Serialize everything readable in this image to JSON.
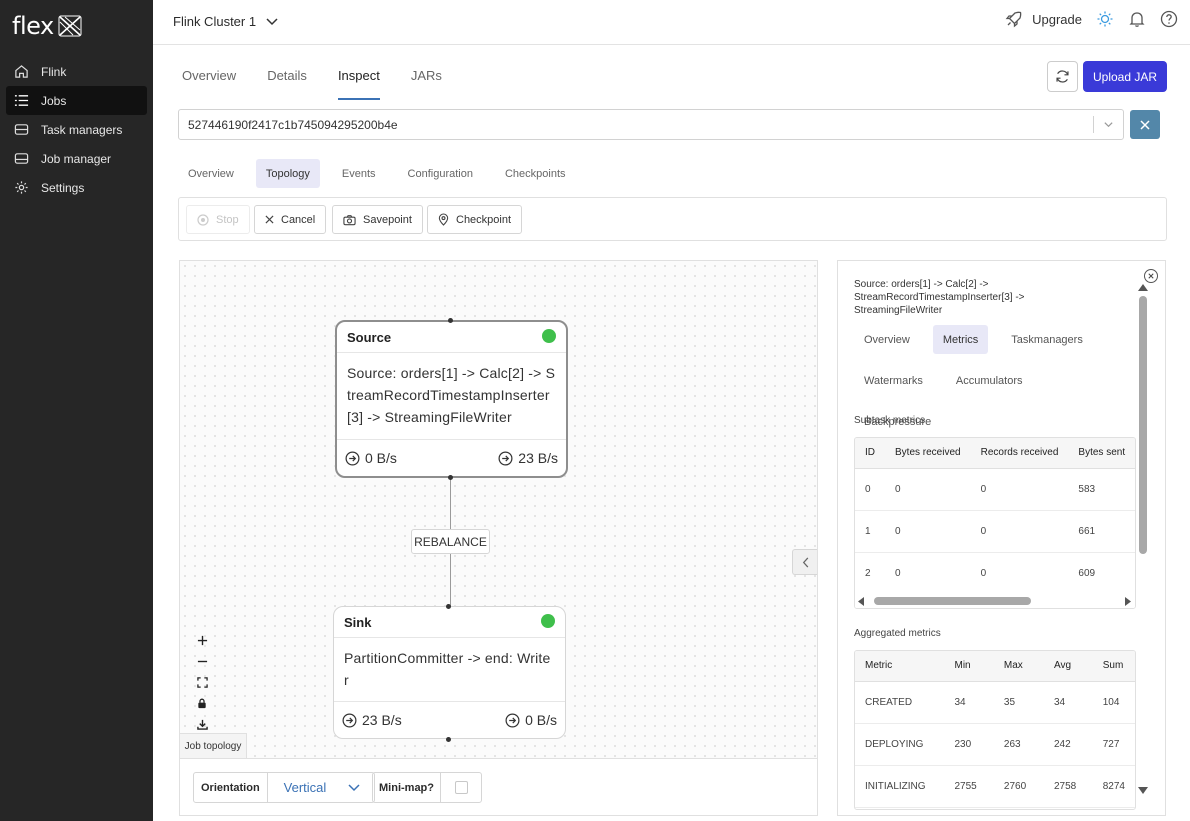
{
  "sidebar": {
    "logo": "flex",
    "items": [
      {
        "label": "Flink",
        "icon": "home-icon"
      },
      {
        "label": "Jobs",
        "icon": "list-icon",
        "active": true
      },
      {
        "label": "Task managers",
        "icon": "server-icon"
      },
      {
        "label": "Job manager",
        "icon": "server-single-icon"
      },
      {
        "label": "Settings",
        "icon": "gear-icon"
      }
    ]
  },
  "topbar": {
    "cluster": "Flink Cluster 1",
    "upgrade": "Upgrade"
  },
  "main_tabs": [
    {
      "label": "Overview"
    },
    {
      "label": "Details"
    },
    {
      "label": "Inspect",
      "active": true
    },
    {
      "label": "JARs"
    }
  ],
  "upload_jar": "Upload JAR",
  "job_select": {
    "value": "527446190f2417c1b745094295200b4e"
  },
  "sub_tabs": [
    {
      "label": "Overview"
    },
    {
      "label": "Topology",
      "active": true
    },
    {
      "label": "Events"
    },
    {
      "label": "Configuration"
    },
    {
      "label": "Checkpoints"
    }
  ],
  "actions": {
    "stop": "Stop",
    "cancel": "Cancel",
    "savepoint": "Savepoint",
    "checkpoint": "Checkpoint"
  },
  "graph": {
    "source": {
      "title": "Source",
      "description": "Source: orders[1] -> Calc[2] -> StreamRecordTimestampInserter[3] -> StreamingFileWriter",
      "in_rate": "0 B/s",
      "out_rate": "23 B/s",
      "status_color": "#3fbf4b"
    },
    "edge_label": "REBALANCE",
    "sink": {
      "title": "Sink",
      "description": "PartitionCommitter -> end: Writer",
      "in_rate": "23 B/s",
      "out_rate": "0 B/s",
      "status_color": "#3fbf4b"
    },
    "caption": "Job topology"
  },
  "bottom": {
    "orientation_label": "Orientation",
    "orientation_value": "Vertical",
    "minimap_label": "Mini-map?"
  },
  "panel": {
    "title": "Source: orders[1] -> Calc[2] -> StreamRecordTimestampInserter[3] -> StreamingFileWriter",
    "tabs": [
      {
        "label": "Overview"
      },
      {
        "label": "Metrics",
        "active": true
      },
      {
        "label": "Taskmanagers"
      },
      {
        "label": "Watermarks"
      },
      {
        "label": "Accumulators"
      },
      {
        "label": "Backpressure"
      }
    ],
    "subtask_label": "Subtask metrics",
    "subtask_headers": [
      "ID",
      "Bytes received",
      "Records received",
      "Bytes sent"
    ],
    "subtask_rows": [
      [
        "0",
        "0",
        "0",
        "583"
      ],
      [
        "1",
        "0",
        "0",
        "661"
      ],
      [
        "2",
        "0",
        "0",
        "609"
      ]
    ],
    "aggregated_label": "Aggregated metrics",
    "aggregated_headers": [
      "Metric",
      "Min",
      "Max",
      "Avg",
      "Sum"
    ],
    "aggregated_rows": [
      [
        "CREATED",
        "34",
        "35",
        "34",
        "104"
      ],
      [
        "DEPLOYING",
        "230",
        "263",
        "242",
        "727"
      ],
      [
        "INITIALIZING",
        "2755",
        "2760",
        "2758",
        "8274"
      ]
    ]
  },
  "colors": {
    "sidebar_bg": "#262626",
    "primary": "#3a3ad8",
    "accent": "#3b72b5",
    "status_ok": "#3fbf4b",
    "close_button": "#5387a9"
  }
}
